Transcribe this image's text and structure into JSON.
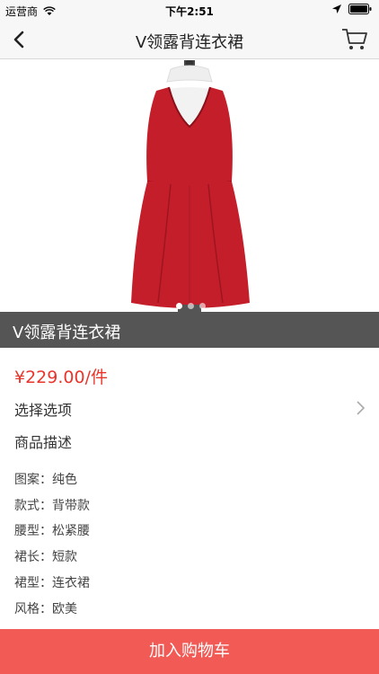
{
  "status": {
    "carrier": "运营商",
    "time": "下午2:51"
  },
  "nav": {
    "title": "V领露背连衣裙"
  },
  "product": {
    "title": "V领露背连衣裙",
    "price": "¥229.00/件",
    "dress_color": "#c41e2a"
  },
  "options": {
    "select_label": "选择选项",
    "description_label": "商品描述"
  },
  "specs": [
    "图案：纯色",
    "款式：背带款",
    "腰型：松紧腰",
    "裙长：短款",
    "裙型：连衣裙",
    "风格：欧美"
  ],
  "footer": {
    "add_to_cart": "加入购物车"
  },
  "colors": {
    "accent": "#e8362d",
    "button": "#f25a55",
    "title_band": "#555555"
  }
}
